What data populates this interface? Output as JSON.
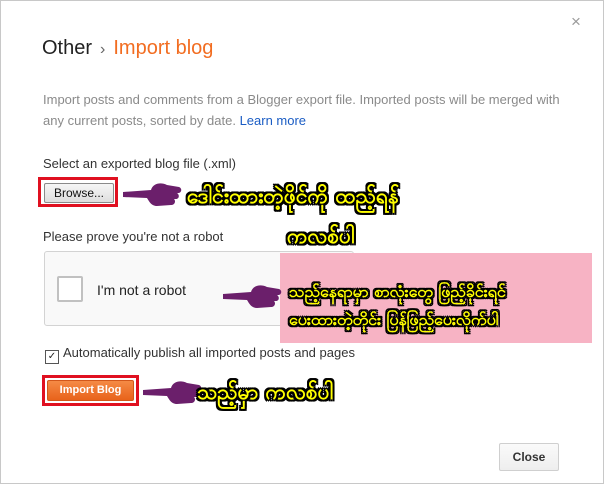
{
  "dialog": {
    "close_icon": "×",
    "breadcrumb_parent": "Other",
    "breadcrumb_sep": "›",
    "title": "Import blog",
    "description": "Import posts and comments from a Blogger export file. Imported posts will be merged with any current posts, sorted by date.",
    "learn_more": "Learn more",
    "file_label": "Select an exported blog file (.xml)",
    "browse_label": "Browse...",
    "robot_prompt": "Please prove you're not a robot",
    "recaptcha_label": "I'm not a robot",
    "auto_publish_label": "Automatically publish all imported posts and pages",
    "auto_publish_checked": true,
    "import_button": "Import Blog",
    "close_button": "Close"
  },
  "annotations": {
    "browse_note_line1": "ဒေါင်းထားတဲ့ဖိုင်ကို ထည့်ရန်",
    "browse_note_line2": "ကလစ်ပါ",
    "captcha_note_line1": "သည့်နေရာမှာ စာလုံးတွေ ဖြည့်ခိုင်းရင်",
    "captcha_note_line2": "ပေးထားတဲ့တိုင်း ပြန်ဖြည့်ပေးလိုက်ပါ",
    "import_note": "သည့်မှာ ကလစ်ပါ"
  },
  "colors": {
    "accent": "#f26d21",
    "link": "#1a5cc4",
    "highlight_border": "#e01020",
    "annotation_text": "#ffff00",
    "pointer": "#6b1f6b",
    "note_background": "#f7b3c4"
  }
}
